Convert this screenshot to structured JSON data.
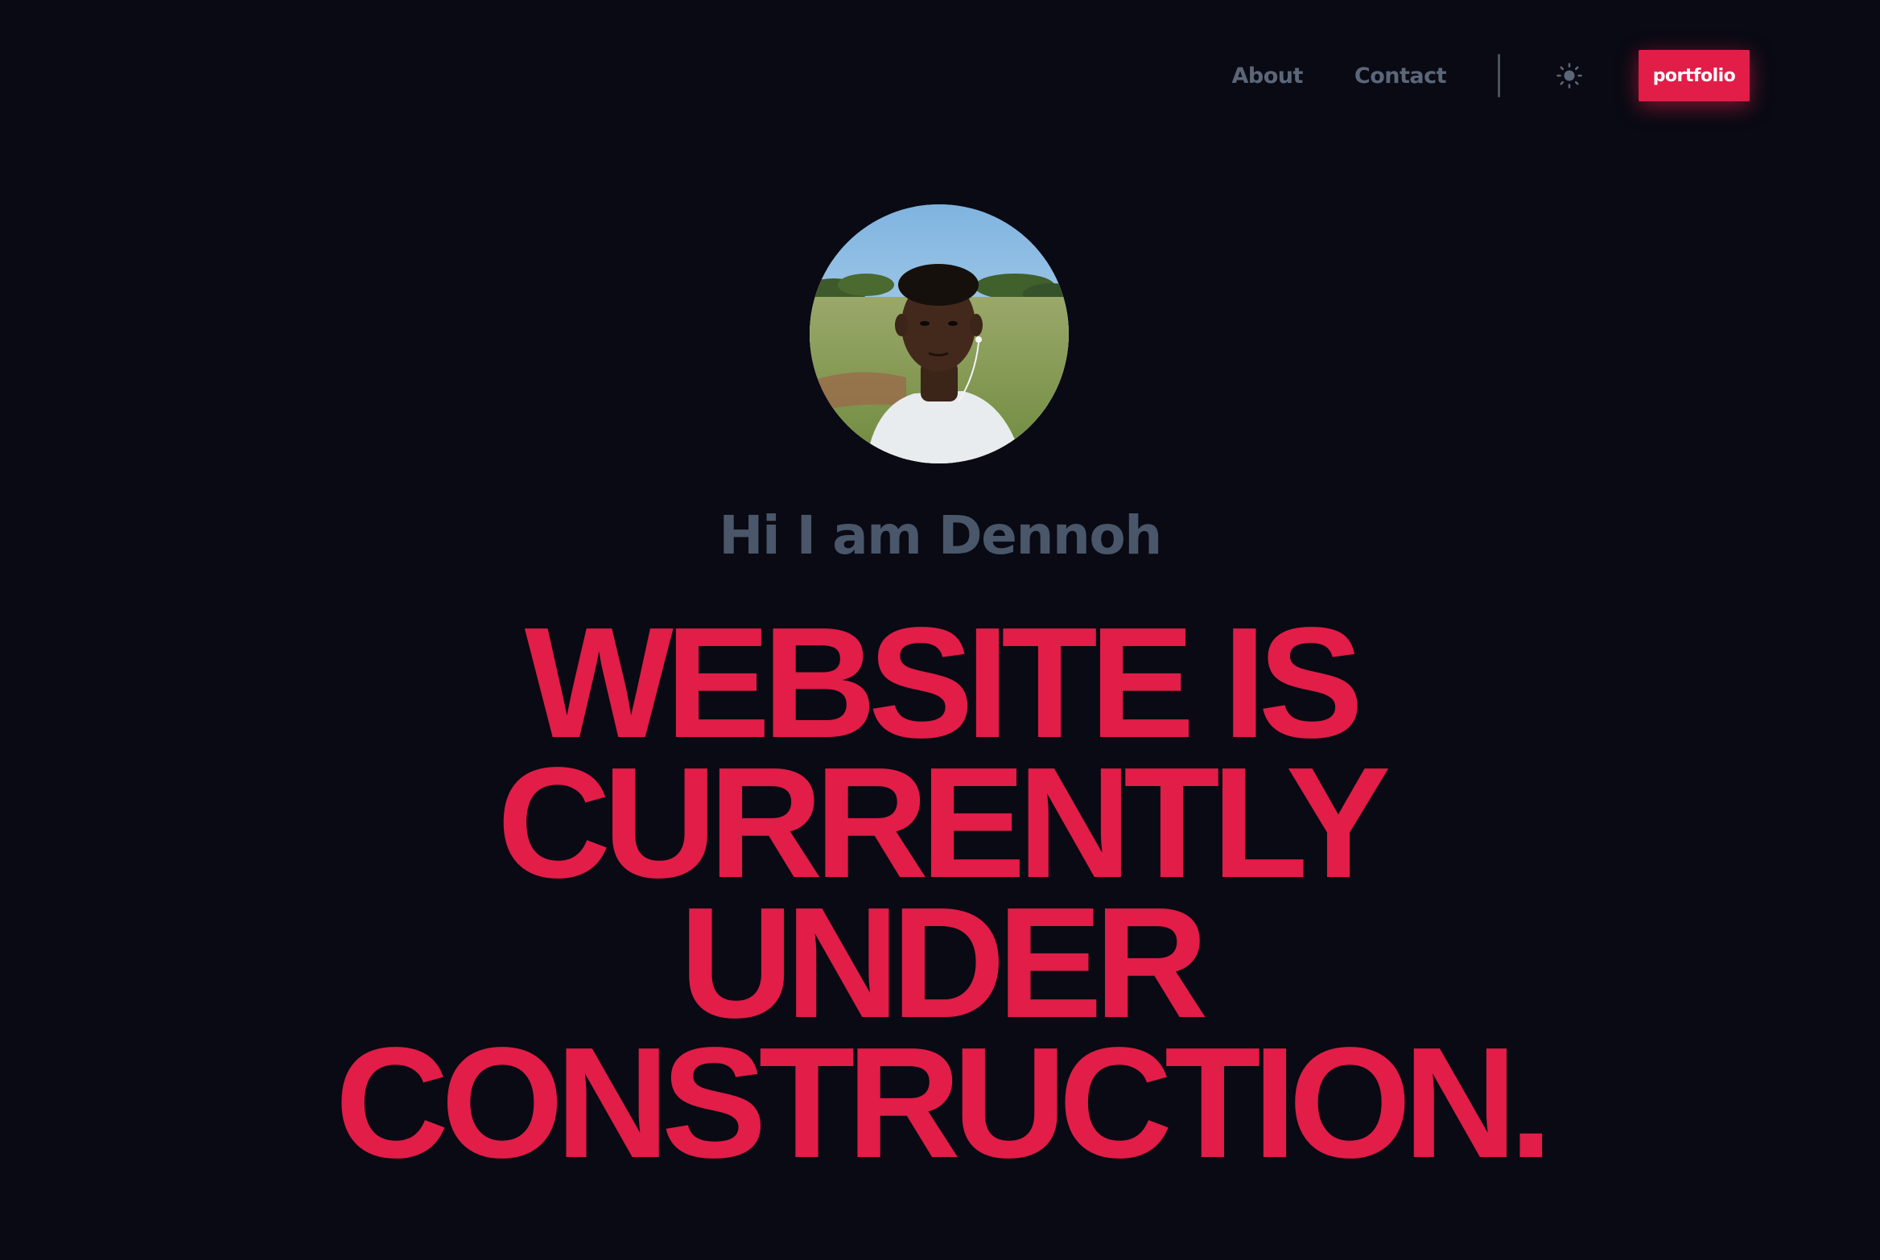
{
  "nav": {
    "about_label": "About",
    "contact_label": "Contact",
    "theme_icon": "sun-icon",
    "portfolio_label": "portfolio"
  },
  "hero": {
    "avatar_alt": "profile photo",
    "greeting": "Hi I am Dennoh",
    "headline_lines": [
      "WEBSITE IS",
      "CURRENTLY",
      "UNDER",
      "CONSTRUCTION."
    ]
  },
  "colors": {
    "background": "#090a13",
    "accent": "#e11d48",
    "muted_text": "#4a5669"
  }
}
